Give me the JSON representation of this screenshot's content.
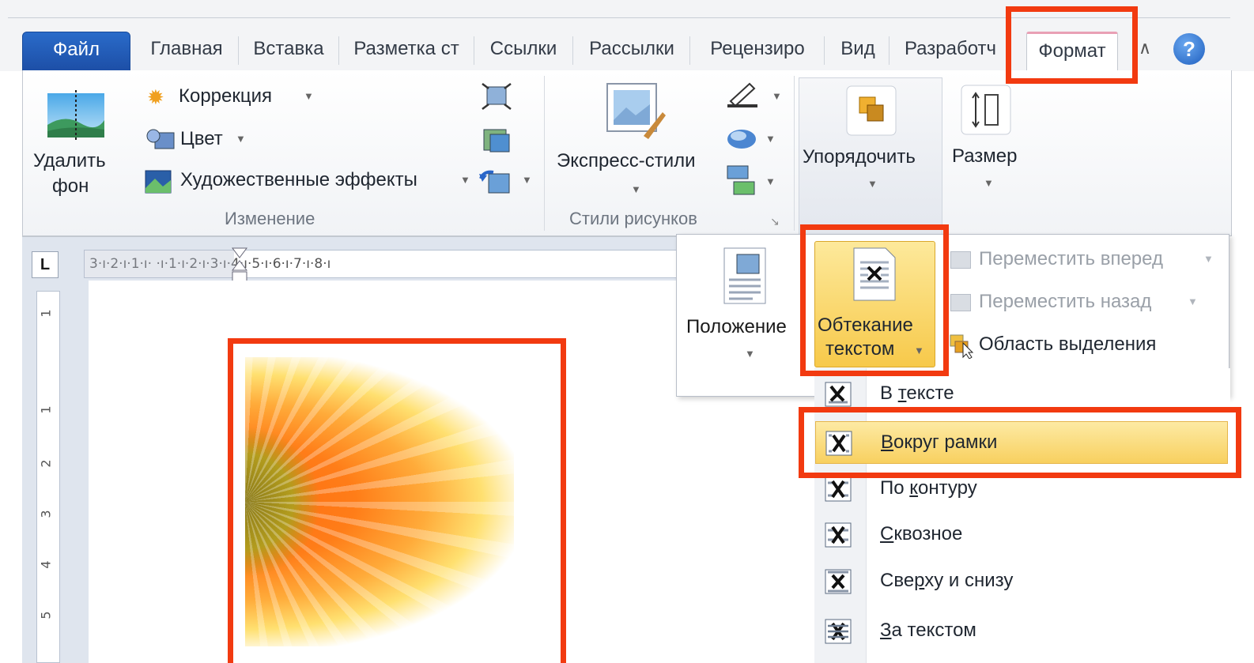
{
  "tabs": [
    {
      "label": "Файл"
    },
    {
      "label": "Главная"
    },
    {
      "label": "Вставка"
    },
    {
      "label": "Разметка ст"
    },
    {
      "label": "Ссылки"
    },
    {
      "label": "Рассылки"
    },
    {
      "label": "Рецензиро"
    },
    {
      "label": "Вид"
    },
    {
      "label": "Разработч"
    },
    {
      "label": "Формат"
    }
  ],
  "help_label": "?",
  "ribbon": {
    "remove_bg": {
      "line1": "Удалить",
      "line2": "фон"
    },
    "adjust": {
      "corrections": "Коррекция",
      "color": "Цвет",
      "artistic": "Художественные эффекты",
      "group_label": "Изменение"
    },
    "styles": {
      "quick_styles": "Экспресс-стили",
      "group_label": "Стили рисунков"
    },
    "arrange": {
      "label": "Упорядочить"
    },
    "size": {
      "label": "Размер"
    }
  },
  "ruler": {
    "tab_selector": "L",
    "horizontal_ticks": "3·ı·2·ı·1·ı·  ·ı·1·ı·2·ı·3·ı·4·ı·5·ı·6·ı·7·ı·8·ı",
    "vertical_ticks": [
      "1",
      "1",
      "2",
      "3",
      "4",
      "5"
    ]
  },
  "arrange_panel": {
    "position": "Положение",
    "wrap_text": {
      "line1": "Обтекание",
      "line2": "текстом"
    },
    "bring_forward": "Переместить вперед",
    "send_backward": "Переместить назад",
    "selection_pane": "Область выделения"
  },
  "wrap_menu": {
    "items": [
      {
        "pre": "В ",
        "accel": "т",
        "post": "ексте"
      },
      {
        "pre": "",
        "accel": "В",
        "post": "округ рамки"
      },
      {
        "pre": "По ",
        "accel": "к",
        "post": "онтуру"
      },
      {
        "pre": "",
        "accel": "С",
        "post": "квозное"
      },
      {
        "pre": "Све",
        "accel": "р",
        "post": "ху и снизу"
      },
      {
        "pre": "",
        "accel": "З",
        "post": "а текстом"
      }
    ]
  },
  "colors": {
    "highlight_red": "#f23a10",
    "file_tab_blue": "#1d4fa7",
    "menu_highlight": "#f8d05f"
  }
}
